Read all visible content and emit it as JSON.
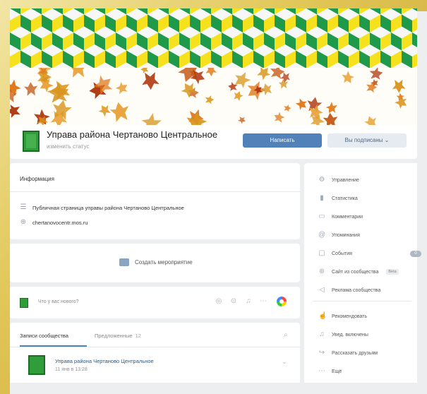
{
  "colors": {
    "primary_button": "#5181b8",
    "secondary_button": "#e5ebf1",
    "link": "#2a5885",
    "cube_yellow": "#f5e11d",
    "cube_green": "#1f9a4a",
    "cube_white": "#f7f7f7",
    "leaf_orange": "#e07a1c",
    "leaf_red": "#b03a12"
  },
  "header": {
    "title": "Управа района Чертаново Центральное",
    "subtitle": "изменить статус",
    "message_button": "Написать",
    "subscribed_button": "Вы подписаны ⌄"
  },
  "info": {
    "heading": "Информация",
    "description": "Публичная страница управы района Чертаново Центральное",
    "website": "chertanovocentr.mos.ru",
    "description_icon": "list-icon",
    "website_icon": "globe-icon"
  },
  "event": {
    "label": "Создать мероприятие",
    "icon": "speech-bubble-icon"
  },
  "composer": {
    "placeholder": "Что у вас нового?",
    "tool_icons": [
      "camera-icon",
      "video-icon",
      "music-icon",
      "more-icon"
    ],
    "poster_icon": "poster-icon"
  },
  "feed": {
    "tab_community": "Записи сообщества",
    "tab_suggested": "Предложенные",
    "tab_suggested_count": "12",
    "post_author": "Управа района Чертаново Центральное",
    "post_time": "11 янв в 13:28"
  },
  "menu": {
    "items": [
      {
        "label": "Управление",
        "icon": "gear-icon"
      },
      {
        "label": "Статистика",
        "icon": "bar-chart-icon"
      },
      {
        "label": "Комментарии",
        "icon": "comment-icon"
      },
      {
        "label": "Упоминания",
        "icon": "at-icon"
      },
      {
        "label": "События",
        "icon": "event-icon",
        "badge": "0"
      },
      {
        "label": "Сайт из сообщества",
        "icon": "globe-icon",
        "badge": "Beta"
      },
      {
        "label": "Реклама сообщества",
        "icon": "megaphone-icon"
      },
      {
        "label": "Рекомендовать",
        "icon": "thumbs-up-icon"
      },
      {
        "label": "Увед. включены",
        "icon": "bell-icon"
      },
      {
        "label": "Рассказать друзьям",
        "icon": "share-icon"
      },
      {
        "label": "Ещё",
        "icon": "more-icon"
      }
    ]
  }
}
